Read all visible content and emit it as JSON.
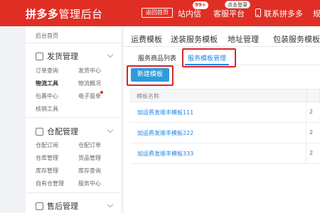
{
  "header": {
    "logo_main": "拼多多",
    "logo_sub": "管理后台",
    "home_button": "返回首页",
    "messages_label": "站内信",
    "messages_badge": "99+",
    "service_label": "客服平台",
    "service_badge": "点击登录",
    "contact_label": "联系拼多多",
    "rules_label": "规"
  },
  "sidebar": {
    "home": "后台首页",
    "groups": [
      {
        "title": "发货管理",
        "links": [
          "订单查询",
          "发货中心",
          "物流工具",
          "物流概况",
          "包裹中心",
          "电子面单",
          "核销工具"
        ]
      },
      {
        "title": "仓配管理",
        "links": [
          "仓配订阅",
          "仓配订单",
          "仓库管理",
          "货品管理",
          "库存管理",
          "库存查询",
          "自有仓管理",
          "服务中心"
        ]
      },
      {
        "title": "售后管理",
        "links": []
      }
    ]
  },
  "main": {
    "top_tabs": [
      "运费模板",
      "送装服务模板",
      "地址管理",
      "包装服务模板"
    ],
    "sub_tabs": [
      "服务商品列表",
      "服务模板管理"
    ],
    "new_button": "新建模板",
    "table": {
      "header": "模板名称",
      "rows": [
        {
          "name": "加运费发顺丰模板111",
          "extra": "2"
        },
        {
          "name": "加运费发顺丰模板222",
          "extra": "2"
        },
        {
          "name": "加运费发顺丰模板333",
          "extra": "2"
        }
      ]
    }
  },
  "colors": {
    "brand": "#e02e24",
    "accent": "#1e88e5",
    "button": "#2d9cdb",
    "highlight": "#d9232e"
  }
}
